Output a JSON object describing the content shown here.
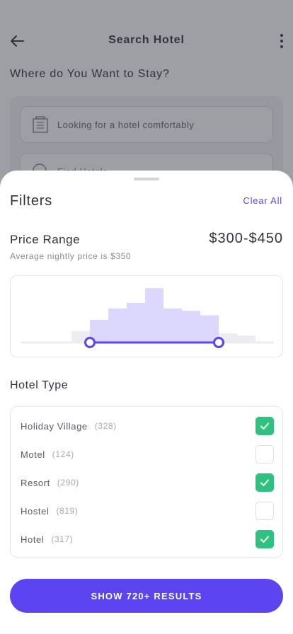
{
  "background": {
    "title": "Search Hotel",
    "question": "Where do You Want to Stay?",
    "search_placeholder": "Looking for a hotel comfortably",
    "find_label": "Find Hotels"
  },
  "sheet": {
    "title": "Filters",
    "clear_all": "Clear All",
    "price": {
      "label": "Price Range",
      "value": "$300-$450",
      "subtitle": "Average nightly price is $350"
    },
    "hotel_type_title": "Hotel Type",
    "hotel_types": [
      {
        "name": "Holiday Village",
        "count": "(328)",
        "checked": true
      },
      {
        "name": "Motel",
        "count": "(124)",
        "checked": false
      },
      {
        "name": "Resort",
        "count": "(290)",
        "checked": true
      },
      {
        "name": "Hostel",
        "count": "(819)",
        "checked": false
      },
      {
        "name": "Hotel",
        "count": "(317)",
        "checked": true
      }
    ],
    "show_results": "SHOW 720+ RESULTS"
  },
  "chart_data": {
    "type": "bar",
    "values": [
      1,
      2,
      3,
      3.5,
      4.8,
      3,
      2.8,
      2.4,
      0.8,
      0.6
    ],
    "selected_range": [
      1,
      7
    ],
    "ylim": [
      0,
      5
    ]
  },
  "colors": {
    "accent": "#5b45f0",
    "check_on": "#2ec27e",
    "bar_selected": "#dcd8fd",
    "bar_unselected": "#ececf1"
  }
}
